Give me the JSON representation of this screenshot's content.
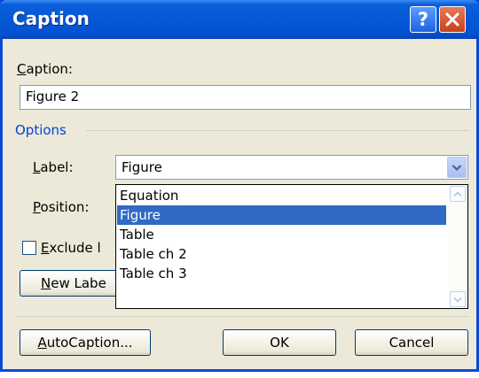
{
  "window": {
    "title": "Caption",
    "help_glyph": "?"
  },
  "caption_field": {
    "label_pre": "",
    "label_key": "C",
    "label_post": "aption:",
    "value": "Figure 2"
  },
  "options_section": {
    "label": "Options"
  },
  "label_field": {
    "label_pre": "",
    "label_key": "L",
    "label_post": "abel:",
    "selected": "Figure"
  },
  "position_field": {
    "label_pre": "",
    "label_key": "P",
    "label_post": "osition:"
  },
  "dropdown": {
    "options": [
      "Equation",
      "Figure",
      "Table",
      "Table ch 2",
      "Table ch 3"
    ],
    "selected_index": 1
  },
  "exclude_checkbox": {
    "label_pre": "",
    "label_key": "E",
    "label_post": "xclude l",
    "checked": false
  },
  "new_label_button": {
    "label_pre": "",
    "label_key": "N",
    "label_post": "ew Labe"
  },
  "autocaption_button": {
    "label_pre": "",
    "label_key": "A",
    "label_post": "utoCaption..."
  },
  "ok_button": {
    "label": "OK"
  },
  "cancel_button": {
    "label": "Cancel"
  },
  "colors": {
    "titlebar": "#0453d0",
    "selection": "#316ac5",
    "section_text": "#0046d5",
    "dialog_bg": "#ece9d8"
  }
}
